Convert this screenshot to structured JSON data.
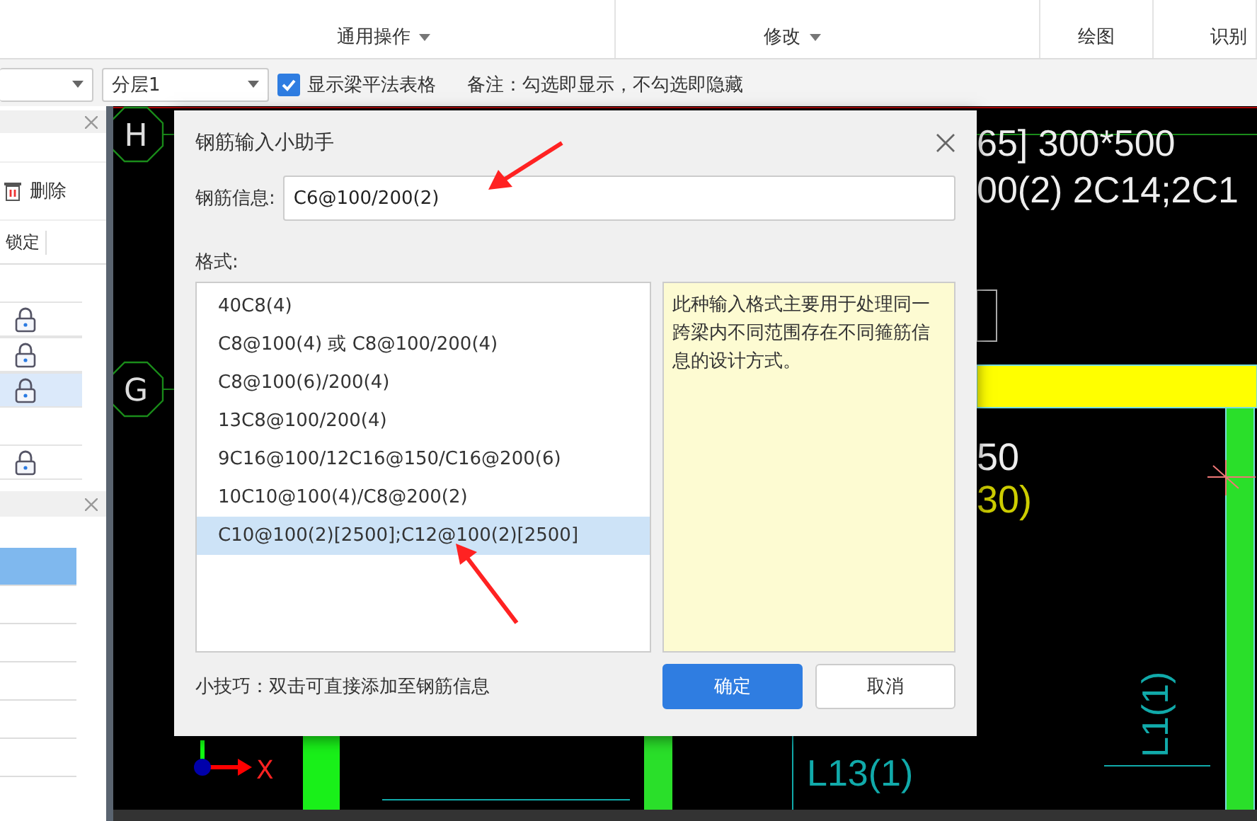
{
  "ribbon": {
    "groups": [
      {
        "label": "通用操作",
        "dropdown": true
      },
      {
        "label": "修改",
        "dropdown": true
      },
      {
        "label": "绘图",
        "dropdown": false
      },
      {
        "label": "识别",
        "dropdown": false
      }
    ]
  },
  "toolbar": {
    "floor_dropdown": {
      "value": "分层1"
    },
    "show_table_checkbox": {
      "label": "显示梁平法表格",
      "checked": true
    },
    "note": "备注：勾选即显示，不勾选即隐藏"
  },
  "left_panel": {
    "delete_button": "删除",
    "columns": [
      "锁定"
    ],
    "rows": [
      {
        "locked": true,
        "selected": false
      },
      {
        "locked": true,
        "selected": false
      },
      {
        "locked": true,
        "selected": true
      },
      {
        "locked": true,
        "selected": false
      }
    ],
    "lower_rows": [
      {
        "selected": true
      },
      {
        "selected": false
      },
      {
        "selected": false
      },
      {
        "selected": false
      },
      {
        "selected": false
      },
      {
        "selected": false
      }
    ]
  },
  "canvas": {
    "axis_labels": [
      "H",
      "G"
    ],
    "beam_texts": [
      "65] 300*500",
      "00(2) 2C14;2C1"
    ],
    "dimension_texts": [
      "50",
      "30)"
    ],
    "beam_labels": [
      "L1(1)",
      "L13(1)"
    ],
    "axis_x_label": "X"
  },
  "dialog": {
    "title": "钢筋输入小助手",
    "field_label": "钢筋信息:",
    "field_value": "C6@100/200(2)",
    "formats_label": "格式:",
    "formats": [
      {
        "text": "40C8(4)",
        "selected": false
      },
      {
        "text": "C8@100(4) 或 C8@100/200(4)",
        "selected": false
      },
      {
        "text": "C8@100(6)/200(4)",
        "selected": false
      },
      {
        "text": "13C8@100/200(4)",
        "selected": false
      },
      {
        "text": "9C16@100/12C16@150/C16@200(6)",
        "selected": false
      },
      {
        "text": "10C10@100(4)/C8@200(2)",
        "selected": false
      },
      {
        "text": "C10@100(2)[2500];C12@100(2)[2500]",
        "selected": true
      }
    ],
    "description": "此种输入格式主要用于处理同一跨梁内不同范围存在不同箍筋信息的设计方式。",
    "tip": "小技巧：双击可直接添加至钢筋信息",
    "buttons": [
      {
        "label": "确定",
        "kind": "primary"
      },
      {
        "label": "取消",
        "kind": "secondary"
      }
    ]
  }
}
